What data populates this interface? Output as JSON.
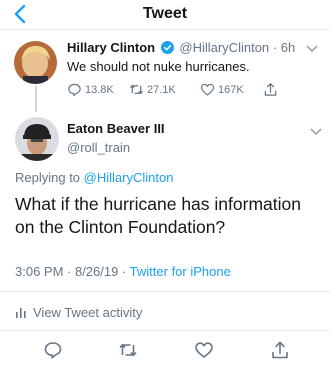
{
  "header": {
    "title": "Tweet",
    "back_icon": "chevron-left-icon"
  },
  "colors": {
    "accent": "#1da1f2",
    "muted": "#657786",
    "text": "#14171a",
    "border": "#e6ecf0"
  },
  "parent_tweet": {
    "name": "Hillary Clinton",
    "handle": "@HillaryClinton",
    "time": "· 6h",
    "text": "We should not nuke hurricanes.",
    "replies": "13.8K",
    "retweets": "27.1K",
    "likes": "167K"
  },
  "reply_tweet": {
    "name": "Eaton Beaver III",
    "handle": "@roll_train",
    "replying_prefix": "Replying to",
    "replying_to": "@HillaryClinton",
    "text": "What if the hurricane has information on the Clinton Foundation?",
    "time": "3:06 PM · 8/26/19 · ",
    "source": "Twitter for iPhone"
  },
  "activity": {
    "label": "View Tweet activity"
  }
}
